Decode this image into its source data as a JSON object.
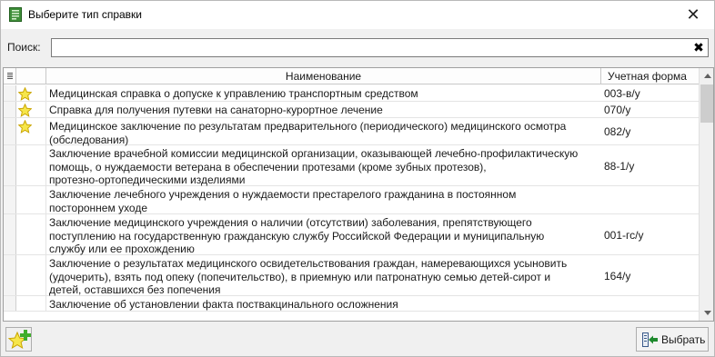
{
  "window": {
    "title": "Выберите тип справки",
    "close_glyph": "✕"
  },
  "search": {
    "label": "Поиск:",
    "value": "",
    "placeholder": "",
    "clear_glyph": "✖"
  },
  "grid": {
    "columns": {
      "name": "Наименование",
      "form": "Учетная форма"
    },
    "rows": [
      {
        "name": "Медицинская справка о допуске к управлению транспортным средством",
        "form": "003-в/у",
        "starred": true
      },
      {
        "name": "Справка для получения путевки на санаторно-курортное лечение",
        "form": "070/у",
        "starred": true
      },
      {
        "name": "Медицинское заключение по результатам предварительного (периодического) медицинского осмотра\n(обследования)",
        "form": "082/у",
        "starred": true
      },
      {
        "name": "Заключение врачебной комиссии медицинской организации, оказывающей лечебно-профилактическую\nпомощь, о нуждаемости ветерана в обеспечении протезами (кроме зубных протезов),\nпротезно-ортопедическими изделиями",
        "form": "88-1/у",
        "starred": false
      },
      {
        "name": "Заключение лечебного учреждения о нуждаемости престарелого гражданина в постоянном\nпостороннем уходе",
        "form": "",
        "starred": false
      },
      {
        "name": "Заключение медицинского учреждения о наличии (отсутствии) заболевания, препятствующего\nпоступлению на государственную гражданскую службу Российской Федерации и муниципальную\nслужбу или ее прохождению",
        "form": "001-гс/у",
        "starred": false
      },
      {
        "name": "Заключение о результатах медицинского освидетельствования граждан, намеревающихся усыновить\n(удочерить), взять под опеку (попечительство), в приемную или патронатную семью детей-сирот и\nдетей, оставшихся без попечения",
        "form": "164/у",
        "starred": false
      },
      {
        "name": "Заключение об установлении факта поствакцинального осложнения",
        "form": "",
        "starred": false
      }
    ]
  },
  "buttons": {
    "select_label": "Выбрать"
  },
  "icons": {
    "title": "app-form-icon",
    "star": "star-icon",
    "add": "add-favorite-icon",
    "select": "select-arrow-icon"
  },
  "colors": {
    "star_fill": "#f6e64b",
    "star_stroke": "#c9a400",
    "add_plus": "#3fae2a",
    "select_arrow": "#1f8a2e"
  }
}
